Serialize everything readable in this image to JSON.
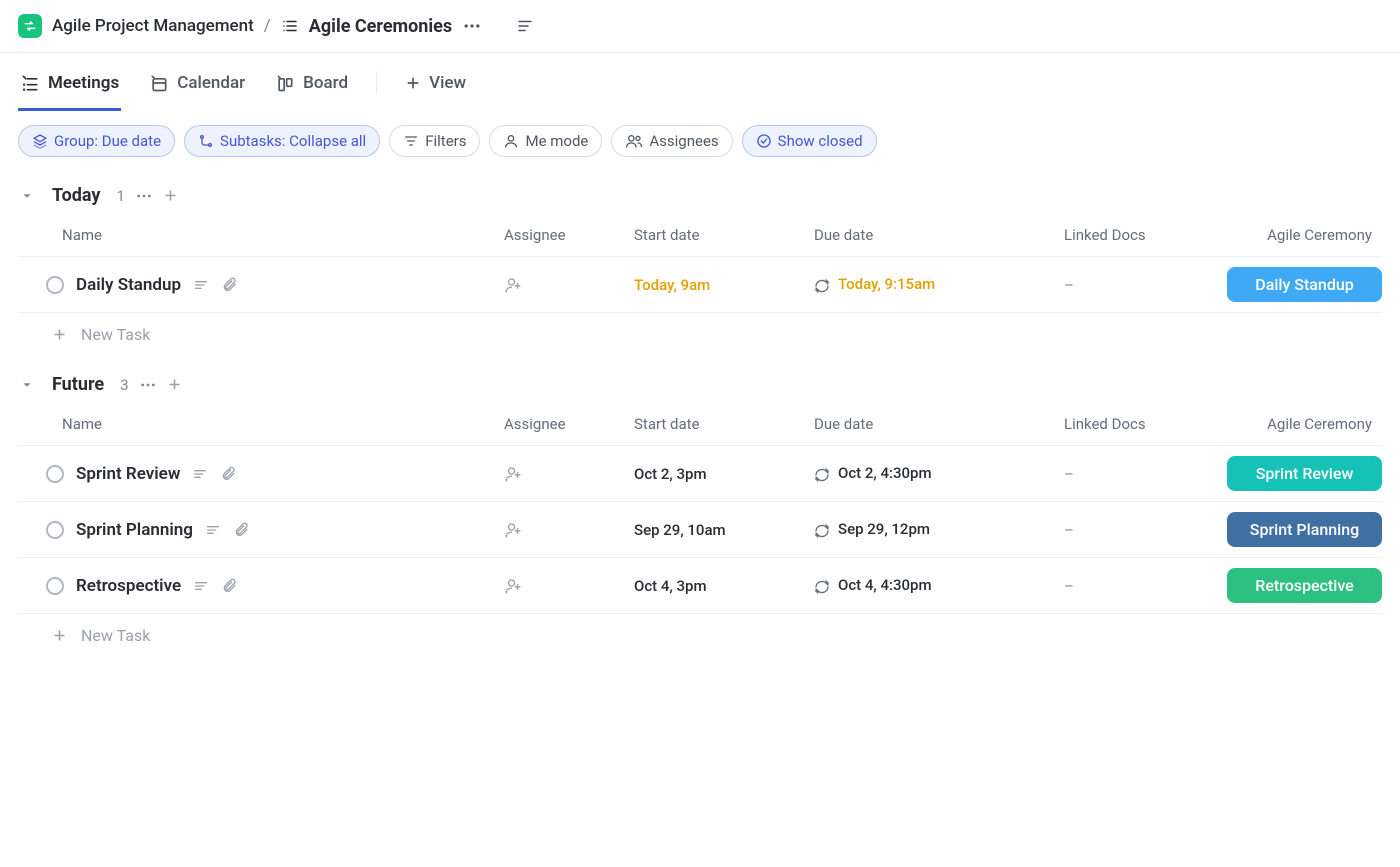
{
  "breadcrumb": {
    "space": "Agile Project Management",
    "separator": "/",
    "list": "Agile Ceremonies"
  },
  "views": [
    {
      "label": "Meetings",
      "active": true,
      "icon": "list-icon"
    },
    {
      "label": "Calendar",
      "active": false,
      "icon": "calendar-icon"
    },
    {
      "label": "Board",
      "active": false,
      "icon": "board-icon"
    },
    {
      "label": "View",
      "active": false,
      "icon": "plus-icon",
      "is_add": true
    }
  ],
  "filters": {
    "group_by": "Group: Due date",
    "subtasks": "Subtasks: Collapse all",
    "filters": "Filters",
    "me_mode": "Me mode",
    "assignees": "Assignees",
    "show_closed": "Show closed"
  },
  "columns": {
    "name": "Name",
    "assignee": "Assignee",
    "start": "Start date",
    "due": "Due date",
    "docs": "Linked Docs",
    "ceremony": "Agile Ceremony"
  },
  "groups": [
    {
      "title": "Today",
      "count": "1",
      "rows": [
        {
          "name": "Daily Standup",
          "start": "Today, 9am",
          "due": "Today, 9:15am",
          "docs": "–",
          "ceremony": "Daily Standup",
          "ceremony_color": "#3fa9f5",
          "date_style": "orange"
        }
      ]
    },
    {
      "title": "Future",
      "count": "3",
      "rows": [
        {
          "name": "Sprint Review",
          "start": "Oct 2, 3pm",
          "due": "Oct 2, 4:30pm",
          "docs": "–",
          "ceremony": "Sprint Review",
          "ceremony_color": "#16c2b5",
          "date_style": "dark"
        },
        {
          "name": "Sprint Planning",
          "start": "Sep 29, 10am",
          "due": "Sep 29, 12pm",
          "docs": "–",
          "ceremony": "Sprint Planning",
          "ceremony_color": "#3f6fa3",
          "date_style": "dark"
        },
        {
          "name": "Retrospective",
          "start": "Oct 4, 3pm",
          "due": "Oct 4, 4:30pm",
          "docs": "–",
          "ceremony": "Retrospective",
          "ceremony_color": "#2cc180",
          "date_style": "dark"
        }
      ]
    }
  ],
  "new_task": "New Task"
}
